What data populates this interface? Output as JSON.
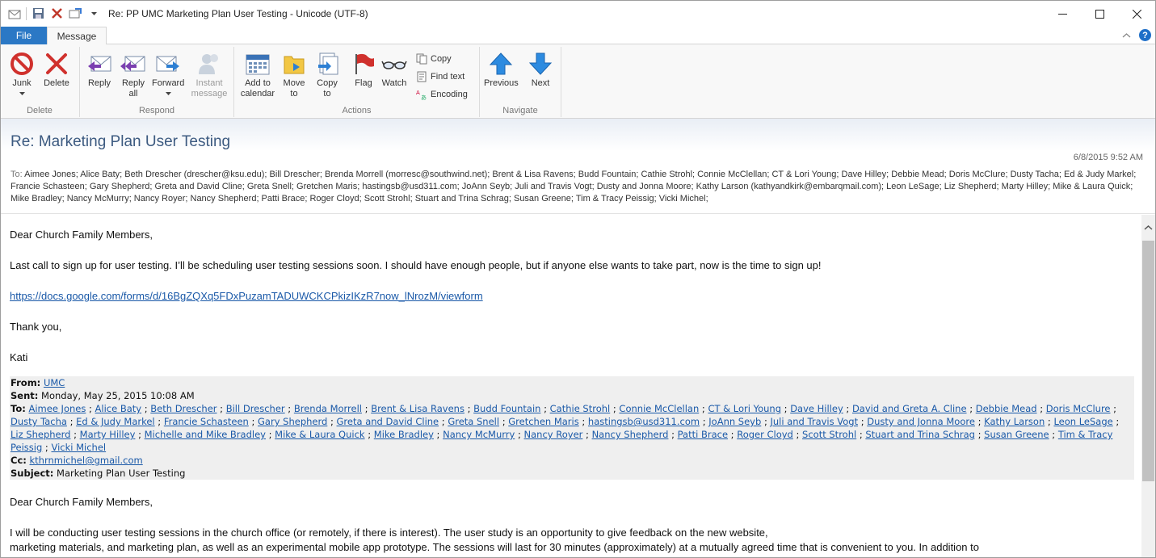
{
  "window": {
    "title": "Re: PP UMC Marketing Plan User Testing  -  Unicode (UTF-8)",
    "minimize": "—",
    "maximize": "☐",
    "close": "✕"
  },
  "tabs": {
    "file": "File",
    "message": "Message"
  },
  "ribbon": {
    "delete_group": {
      "label": "Delete",
      "junk": "Junk",
      "delete": "Delete"
    },
    "respond_group": {
      "label": "Respond",
      "reply": "Reply",
      "reply_all": "Reply all",
      "forward": "Forward",
      "instant_message": "Instant message"
    },
    "actions_group": {
      "label": "Actions",
      "add_to_calendar": "Add to calendar",
      "move_to": "Move to",
      "copy_to": "Copy to",
      "flag": "Flag",
      "watch": "Watch",
      "copy": "Copy",
      "find_text": "Find text",
      "encoding": "Encoding"
    },
    "navigate_group": {
      "label": "Navigate",
      "previous": "Previous",
      "next": "Next"
    }
  },
  "header": {
    "subject": "Re: Marketing Plan User Testing",
    "date": "6/8/2015 9:52 AM",
    "to_label": "To:",
    "to": "Aimee Jones; Alice Baty; Beth Drescher (drescher@ksu.edu); Bill Drescher; Brenda Morrell (morresc@southwind.net); Brent & Lisa Ravens; Budd Fountain; Cathie Strohl; Connie McClellan; CT & Lori Young; Dave Hilley; Debbie Mead; Doris McClure; Dusty Tacha; Ed & Judy Markel; Francie Schasteen; Gary Shepherd; Greta and David Cline; Greta Snell; Gretchen Maris; hastingsb@usd311.com; JoAnn Seyb; Juli and Travis Vogt; Dusty and Jonna Moore; Kathy Larson (kathyandkirk@embarqmail.com); Leon LeSage; Liz Shepherd; Marty Hilley; Mike & Laura Quick; Mike Bradley; Nancy McMurry; Nancy Royer; Nancy Shepherd; Patti Brace; Roger Cloyd; Scott Strohl; Stuart and Trina Schrag; Susan Greene; Tim & Tracy Peissig; Vicki Michel;"
  },
  "body": {
    "greeting": "Dear Church Family Members,",
    "para1": "Last call to sign up for user testing. I’ll be scheduling user testing sessions soon. I should have enough people, but if anyone else wants to take part, now is the time to sign up!",
    "link": "https://docs.google.com/forms/d/16BgZQXq5FDxPuzamTADUWCKCPkizIKzR7now_lNrozM/viewform",
    "thanks": "Thank you,",
    "signature": "Kati",
    "fwd": {
      "from_label": "From:",
      "from": "UMC",
      "sent_label": "Sent:",
      "sent": "Monday, May 25, 2015 10:08 AM",
      "to_label": "To:",
      "to_recipients": [
        "Aimee Jones",
        "Alice Baty",
        "Beth Drescher",
        "Bill Drescher",
        "Brenda Morrell",
        "Brent & Lisa Ravens",
        "Budd Fountain",
        "Cathie Strohl",
        "Connie McClellan",
        "CT & Lori Young",
        "Dave Hilley",
        "David and Greta A. Cline",
        "Debbie Mead",
        "Doris McClure",
        "Dusty Tacha",
        "Ed & Judy Markel",
        "Francie Schasteen",
        "Gary Shepherd",
        "Greta and David Cline",
        "Greta Snell",
        "Gretchen Maris",
        "hastingsb@usd311.com",
        "JoAnn Seyb",
        "Juli and Travis Vogt",
        "Dusty and Jonna Moore",
        "Kathy Larson",
        "Leon LeSage",
        "Liz Shepherd",
        "Marty Hilley",
        "Michelle and Mike Bradley",
        "Mike & Laura Quick",
        "Mike Bradley",
        "Nancy McMurry",
        "Nancy Royer",
        "Nancy Shepherd",
        "Patti Brace",
        "Roger Cloyd",
        "Scott Strohl",
        "Stuart and Trina Schrag",
        "Susan Greene",
        "Tim & Tracy Peissig",
        "Vicki Michel"
      ],
      "cc_label": "Cc:",
      "cc": "kthrnmichel@gmail.com",
      "subject_label": "Subject:",
      "subject": "Marketing Plan User Testing"
    },
    "greeting2": "Dear Church Family Members,",
    "para2_line1": "I will be conducting user testing sessions in the church office (or remotely, if there is interest). The user study is an opportunity to give feedback on the new website,",
    "para2_line2": "marketing materials, and marketing plan, as well as an experimental mobile app prototype. The sessions will last for 30 minutes (approximately) at a mutually agreed time that is convenient to you. In addition to"
  }
}
